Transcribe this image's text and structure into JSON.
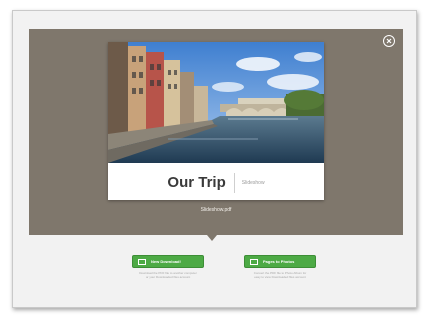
{
  "document": {
    "title": "Our Trip",
    "subtitle": "Slideshow"
  },
  "viewer": {
    "file_name": "Slideshow.pdf",
    "close_icon": "close-icon"
  },
  "actions": {
    "new_download": {
      "label": "New Download!",
      "icon": "download-icon",
      "note_line1": "Download the PDF file to another computer",
      "note_line2": "or your Downloaded files account"
    },
    "pages_to_photos": {
      "label": "Pages to Photos",
      "icon": "photo-icon",
      "note_line1": "Convert the PDF file to Photo Album for",
      "note_line2": "easy to view Downloaded files account"
    }
  },
  "colors": {
    "viewer_background": "#7f776c",
    "button_green": "#4daa45"
  }
}
